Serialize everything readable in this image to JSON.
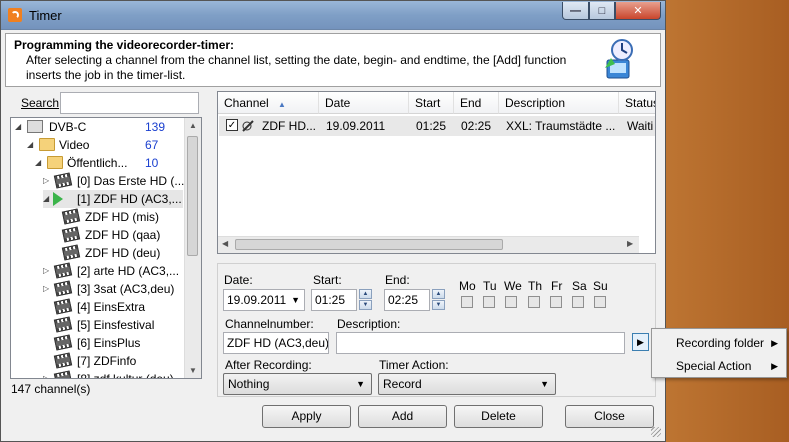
{
  "window": {
    "title": "Timer"
  },
  "header": {
    "title": "Programming the videorecorder-timer:",
    "description": "After selecting a channel from the channel list, setting the date, begin- and endtime, the [Add] function inserts the job in the timer-list."
  },
  "search": {
    "label": "Search",
    "value": ""
  },
  "tree": {
    "items": [
      {
        "label": "DVB-C",
        "count": "139"
      },
      {
        "label": "Video",
        "count": "67"
      },
      {
        "label": "Öffentlich...",
        "count": "10"
      },
      {
        "label": "[0]  Das Erste HD (..."
      },
      {
        "label": "[1]  ZDF HD (AC3,..."
      },
      {
        "label": "ZDF HD (mis)"
      },
      {
        "label": "ZDF HD (qaa)"
      },
      {
        "label": "ZDF HD (deu)"
      },
      {
        "label": "[2]  arte HD (AC3,..."
      },
      {
        "label": "[3]  3sat (AC3,deu)"
      },
      {
        "label": "[4]  EinsExtra"
      },
      {
        "label": "[5]  Einsfestival"
      },
      {
        "label": "[6]  EinsPlus"
      },
      {
        "label": "[7]  ZDFinfo"
      },
      {
        "label": "[8]  zdf.kultur (deu)"
      }
    ],
    "status": "147 channel(s)"
  },
  "timerlist": {
    "columns": [
      "Channel",
      "Date",
      "Start",
      "End",
      "Description",
      "Status"
    ],
    "rows": [
      {
        "channel": "ZDF HD...",
        "date": "19.09.2011",
        "start": "01:25",
        "end": "02:25",
        "description": "XXL: Traumstädte ...",
        "status": "Waiti"
      }
    ]
  },
  "form": {
    "date_label": "Date:",
    "date_value": "19.09.2011",
    "start_label": "Start:",
    "start_value": "01:25",
    "end_label": "End:",
    "end_value": "02:25",
    "days": [
      "Mo",
      "Tu",
      "We",
      "Th",
      "Fr",
      "Sa",
      "Su"
    ],
    "channelnumber_label": "Channelnumber:",
    "channelnumber_value": "ZDF HD (AC3,deu)",
    "description_label": "Description:",
    "description_value": "",
    "after_recording_label": "After Recording:",
    "after_recording_value": "Nothing",
    "timer_action_label": "Timer Action:",
    "timer_action_value": "Record"
  },
  "buttons": {
    "apply": "Apply",
    "add": "Add",
    "delete": "Delete",
    "close": "Close"
  },
  "context_menu": {
    "items": [
      "Recording folder",
      "Special Action"
    ]
  }
}
